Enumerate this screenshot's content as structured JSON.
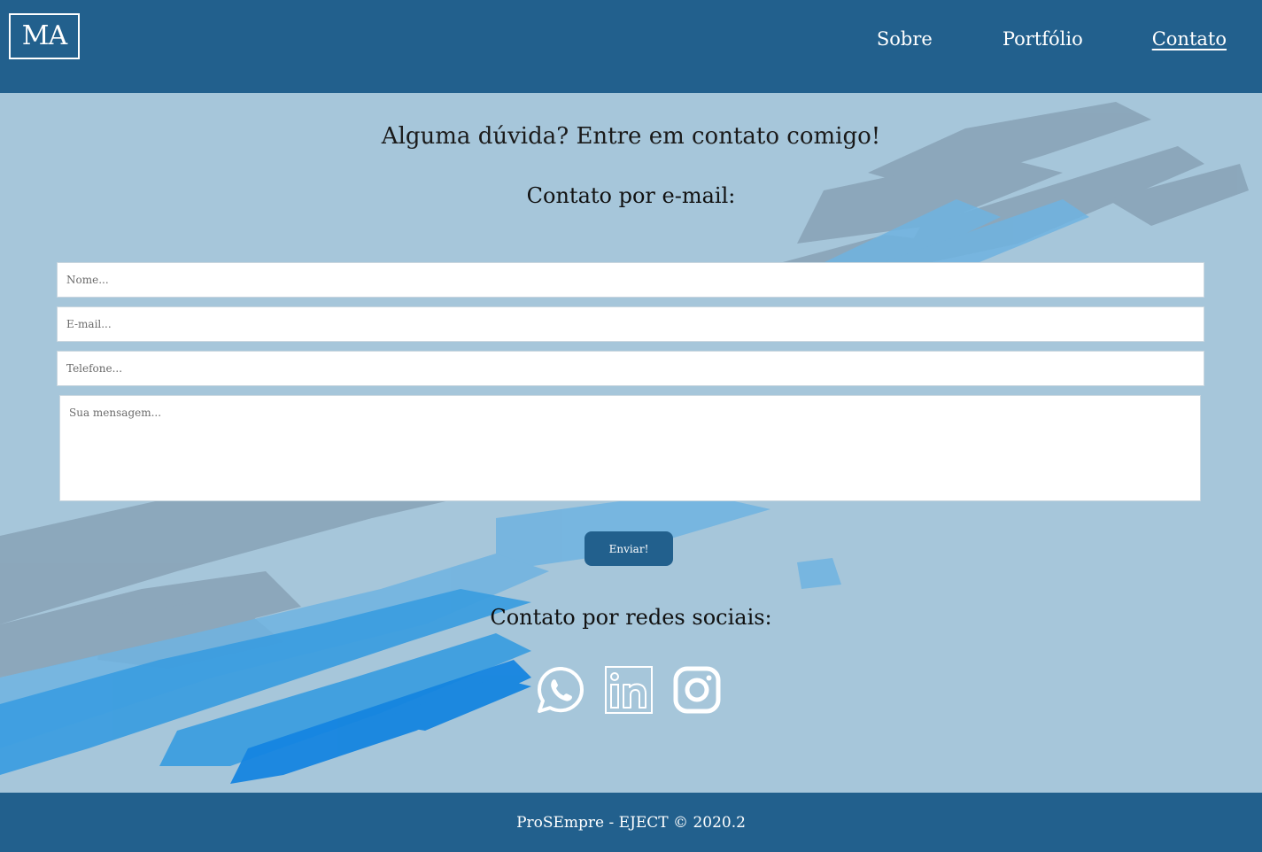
{
  "header": {
    "logo_text": "MA",
    "nav": {
      "sobre": "Sobre",
      "portfolio": "Portfólio",
      "contato": "Contato",
      "active": "Contato"
    }
  },
  "main": {
    "heading": "Alguma dúvida? Entre em contato comigo!",
    "email_heading": "Contato por e-mail:",
    "form": {
      "nome_placeholder": "Nome...",
      "email_placeholder": "E-mail...",
      "telefone_placeholder": "Telefone...",
      "mensagem_placeholder": "Sua mensagem...",
      "submit_label": "Enviar!"
    },
    "social_heading": "Contato por redes sociais:",
    "social_icons": [
      "whatsapp-icon",
      "linkedin-icon",
      "instagram-icon"
    ]
  },
  "footer": {
    "text": "ProSEmpre - EJECT © 2020.2"
  },
  "colors": {
    "primary": "#22608d",
    "background": "#a6c6da",
    "white": "#ffffff"
  }
}
